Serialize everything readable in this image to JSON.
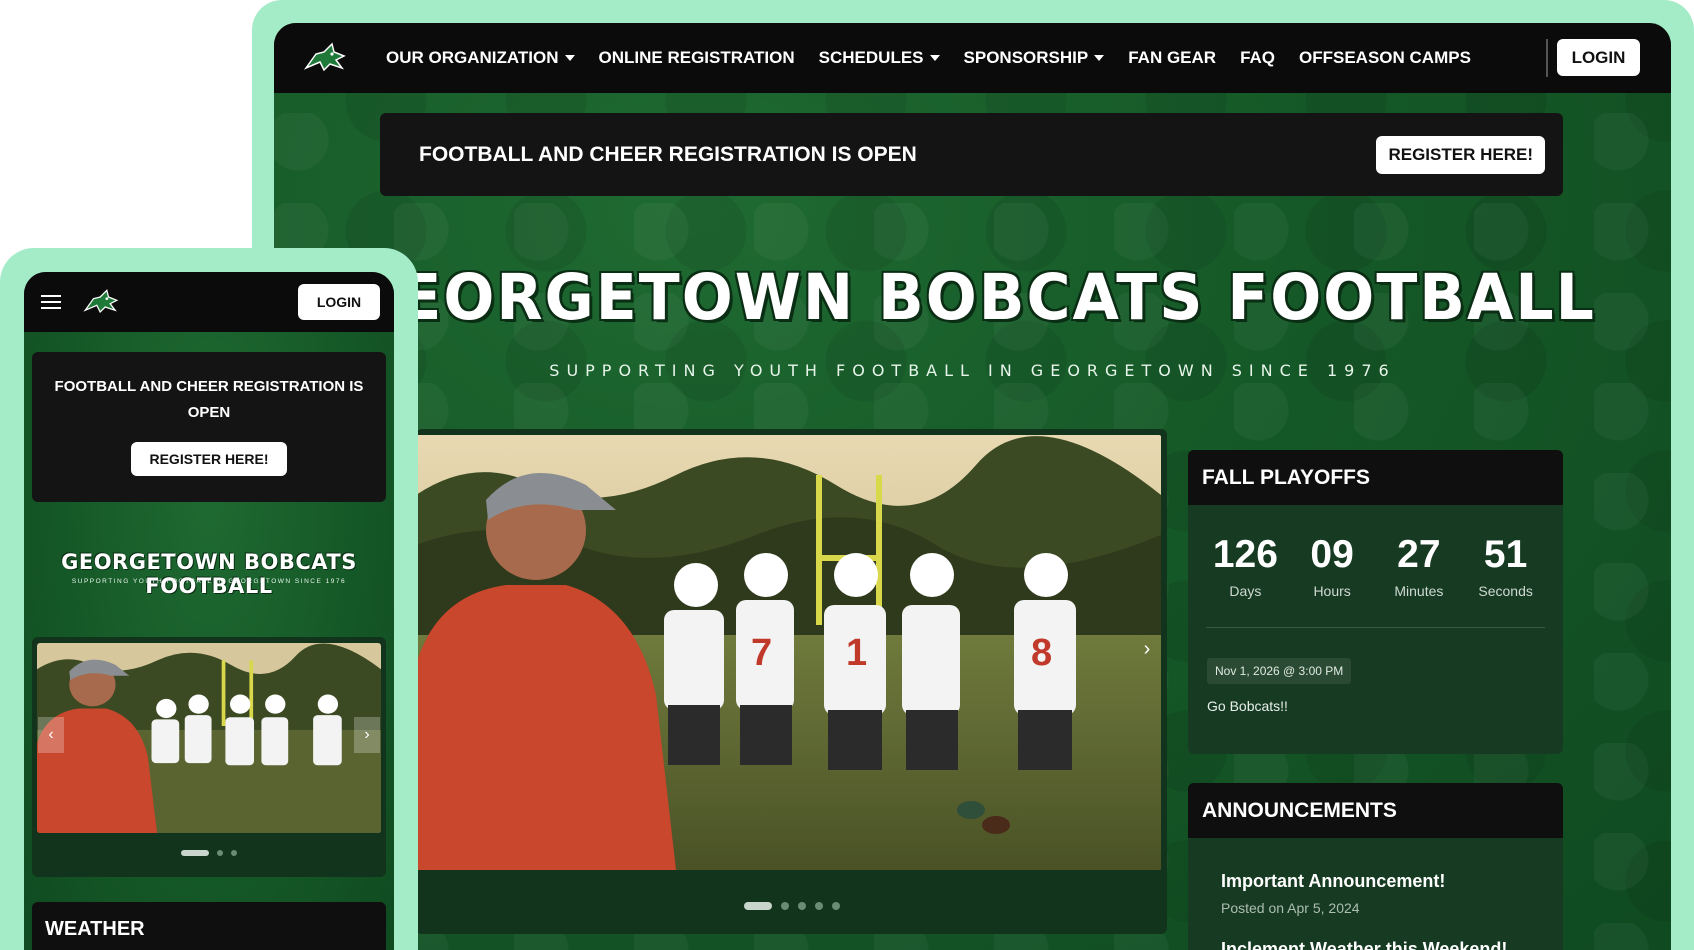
{
  "desktop": {
    "nav": {
      "items": [
        {
          "label": "OUR ORGANIZATION",
          "dropdown": true
        },
        {
          "label": "ONLINE REGISTRATION",
          "dropdown": false
        },
        {
          "label": "SCHEDULES",
          "dropdown": true
        },
        {
          "label": "SPONSORSHIP",
          "dropdown": true
        },
        {
          "label": "FAN GEAR",
          "dropdown": false
        },
        {
          "label": "FAQ",
          "dropdown": false
        },
        {
          "label": "OFFSEASON CAMPS",
          "dropdown": false
        }
      ],
      "login_label": "LOGIN"
    },
    "registration_bar": {
      "text": "FOOTBALL AND CHEER REGISTRATION IS OPEN",
      "button_label": "REGISTER HERE!"
    },
    "hero": {
      "title": "GEORGETOWN BOBCATS FOOTBALL",
      "subtitle": "SUPPORTING YOUTH FOOTBALL IN GEORGETOWN SINCE 1976"
    },
    "carousel": {
      "slide_count": 5,
      "active_index": 0
    },
    "playoffs": {
      "heading": "FALL PLAYOFFS",
      "countdown": [
        {
          "value": "126",
          "label": "Days"
        },
        {
          "value": "09",
          "label": "Hours"
        },
        {
          "value": "27",
          "label": "Minutes"
        },
        {
          "value": "51",
          "label": "Seconds"
        }
      ],
      "event_date": "Nov 1, 2026 @ 3:00 PM",
      "event_text": "Go Bobcats!!"
    },
    "announcements": {
      "heading": "ANNOUNCEMENTS",
      "items": [
        {
          "title": "Important Announcement!",
          "date": "Posted on Apr 5, 2024"
        },
        {
          "title": "Inclement Weather this Weekend!",
          "date": ""
        }
      ]
    }
  },
  "mobile": {
    "login_label": "LOGIN",
    "registration": {
      "text": "FOOTBALL AND CHEER REGISTRATION IS OPEN",
      "button_label": "REGISTER HERE!"
    },
    "hero": {
      "title": "GEORGETOWN BOBCATS FOOTBALL",
      "subtitle": "SUPPORTING YOUTH FOOTBALL IN GEORGETOWN SINCE 1976"
    },
    "carousel": {
      "slide_count": 3,
      "active_index": 0
    },
    "weather_heading": "WEATHER"
  },
  "colors": {
    "brand_green": "#1a5e2b",
    "nav_black": "#0b0b0b",
    "frame_mint": "#a4ecc8",
    "card_green": "#163a22"
  },
  "icons": {
    "logo": "bobcat-logo-icon",
    "menu": "hamburger-icon",
    "next": "chevron-right-icon",
    "prev": "chevron-left-icon"
  }
}
